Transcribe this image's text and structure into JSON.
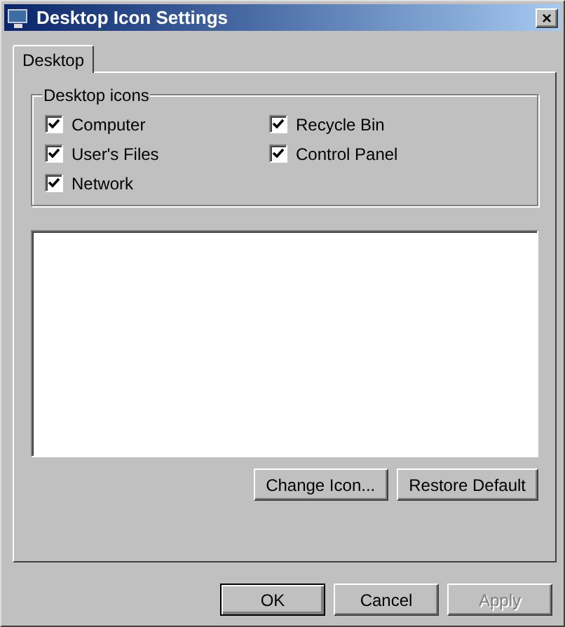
{
  "window": {
    "title": "Desktop Icon Settings",
    "close": "×"
  },
  "tabs": [
    {
      "label": "Desktop",
      "selected": true
    }
  ],
  "group": {
    "title": "Desktop icons",
    "columns": [
      [
        {
          "label": "Computer",
          "checked": true
        },
        {
          "label": "User's Files",
          "checked": true
        },
        {
          "label": "Network",
          "checked": true
        }
      ],
      [
        {
          "label": "Recycle Bin",
          "checked": true
        },
        {
          "label": "Control Panel",
          "checked": true
        }
      ]
    ]
  },
  "icon_buttons": [
    {
      "label": "Change Icon..."
    },
    {
      "label": "Restore Default"
    }
  ],
  "buttons": [
    {
      "label": "OK",
      "default": true,
      "disabled": false
    },
    {
      "label": "Cancel",
      "default": false,
      "disabled": false
    },
    {
      "label": "Apply",
      "default": false,
      "disabled": true
    }
  ]
}
